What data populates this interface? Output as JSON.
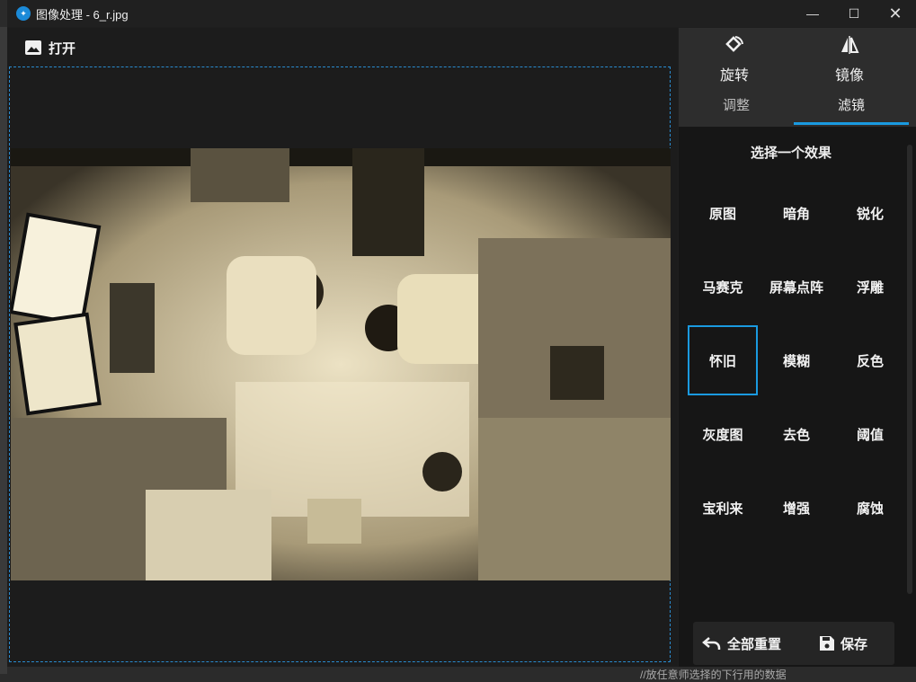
{
  "window": {
    "title": "图像处理 - 6_r.jpg",
    "app_icon": "app-icon"
  },
  "toolbar": {
    "open_label": "打开",
    "open_icon": "image-icon"
  },
  "tools": {
    "rotate_label": "旋转",
    "mirror_label": "镜像"
  },
  "tabs": [
    {
      "label": "调整",
      "active": false
    },
    {
      "label": "滤镜",
      "active": true
    }
  ],
  "effects": {
    "title": "选择一个效果",
    "items": [
      "原图",
      "暗角",
      "锐化",
      "马赛克",
      "屏幕点阵",
      "浮雕",
      "怀旧",
      "模糊",
      "反色",
      "灰度图",
      "去色",
      "阈值",
      "宝利来",
      "增强",
      "腐蚀"
    ],
    "selected": "怀旧"
  },
  "actions": {
    "reset_label": "全部重置",
    "save_label": "保存"
  },
  "colors": {
    "accent": "#1a9ae0",
    "sepia": "#c9bb93"
  },
  "background_text": "//放任意师选择的下行用的数据"
}
